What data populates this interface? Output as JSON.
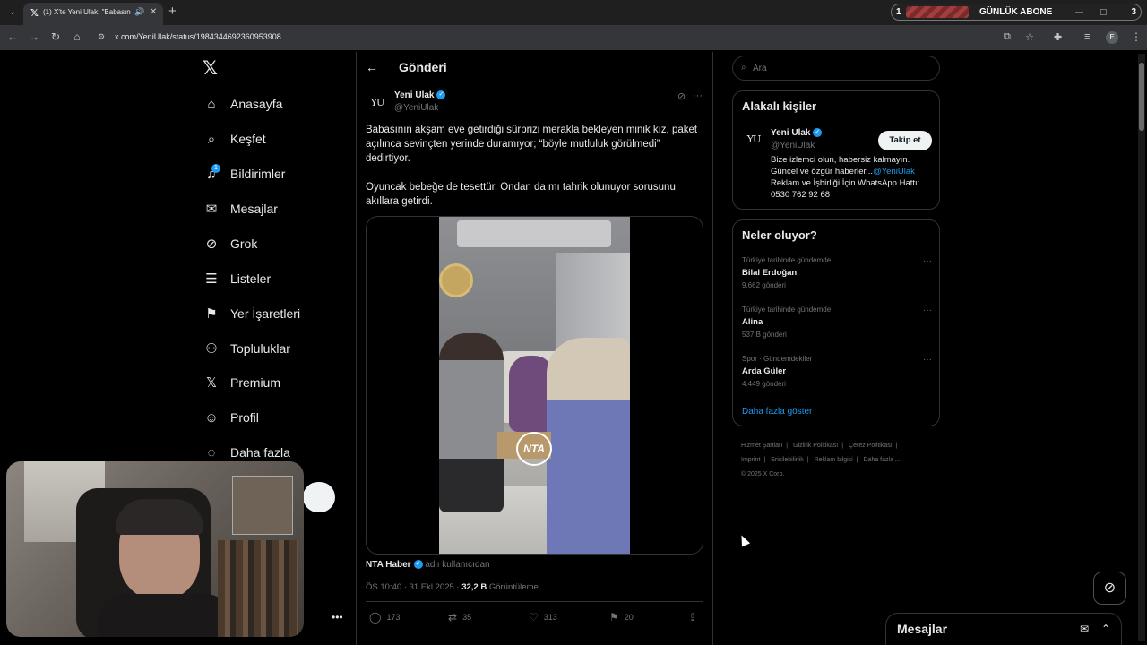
{
  "browser": {
    "tab_title": "(1) X'te Yeni Ulak: \"Babasın",
    "url": "x.com/YeniUlak/status/1984344692360953908",
    "profile_initial": "E"
  },
  "stream_widget": {
    "count": "1",
    "label": "GÜNLÜK ABONE",
    "goal": "3"
  },
  "sidebar": {
    "items": [
      {
        "label": "Anasayfa",
        "icon": "home-icon"
      },
      {
        "label": "Keşfet",
        "icon": "search-icon"
      },
      {
        "label": "Bildirimler",
        "icon": "bell-icon",
        "badge": "1"
      },
      {
        "label": "Mesajlar",
        "icon": "mail-icon"
      },
      {
        "label": "Grok",
        "icon": "grok-icon"
      },
      {
        "label": "Listeler",
        "icon": "list-icon"
      },
      {
        "label": "Yer İşaretleri",
        "icon": "bookmark-icon"
      },
      {
        "label": "Topluluklar",
        "icon": "people-icon"
      },
      {
        "label": "Premium",
        "icon": "x-icon"
      },
      {
        "label": "Profil",
        "icon": "user-icon"
      },
      {
        "label": "Daha fazla",
        "icon": "more-circle-icon"
      }
    ]
  },
  "post": {
    "header_title": "Gönderi",
    "author_name": "Yeni Ulak",
    "author_handle": "@YeniUlak",
    "avatar_text": "YU",
    "text_1": "Babasının akşam eve getirdiği sürprizi merakla bekleyen minik kız, paket açılınca sevinçten yerinde duramıyor; “böyle mutluluk görülmedi” dedirtiyor.",
    "text_2": "Oyuncak bebeğe de tesettür. Ondan da mı tahrik olunuyor sorusunu akıllara getirdi.",
    "video_logo": "NTA",
    "source_name": "NTA Haber",
    "source_suffix": "adlı kullanıcıdan",
    "timestamp": "ÖS 10:40 · 31 Ekl 2025 · ",
    "views": "32,2 B",
    "views_label": " Görüntüleme",
    "replies": "173",
    "reposts": "35",
    "likes": "313",
    "bookmarks": "20"
  },
  "right": {
    "search_placeholder": "Ara",
    "related_title": "Alakalı kişiler",
    "person_name": "Yeni Ulak",
    "person_handle": "@YeniUlak",
    "follow_label": "Takip et",
    "bio_text": "Bize izlemci olun, habersiz kalmayın. Güncel ve özgür haberler...",
    "bio_link": "@YeniUlak",
    "bio_text_2": "Reklam ve İşbirliği İçin WhatsApp Hattı: 0530 762 92 68",
    "trends_title": "Neler oluyor?",
    "trends": [
      {
        "context": "Türkiye tarihinde gündemde",
        "name": "Bilal Erdoğan",
        "count": "9.662 gönderi"
      },
      {
        "context": "Türkiye tarihinde gündemde",
        "name": "Alina",
        "count": "537 B gönderi"
      },
      {
        "context": "Spor · Gündemdekiler",
        "name": "Arda Güler",
        "count": "4.449 gönderi"
      }
    ],
    "show_more": "Daha fazla göster",
    "footer": [
      "Hizmet Şartları",
      "|",
      "Gizlilik Politikası",
      "|",
      "Çerez Politikası",
      "|",
      "Imprint",
      "|",
      "Erişilebilirlik",
      "|",
      "Reklam bilgisi",
      "|",
      "Daha fazla ...",
      "© 2025 X Corp."
    ]
  },
  "messages_drawer": {
    "title": "Mesajlar"
  }
}
